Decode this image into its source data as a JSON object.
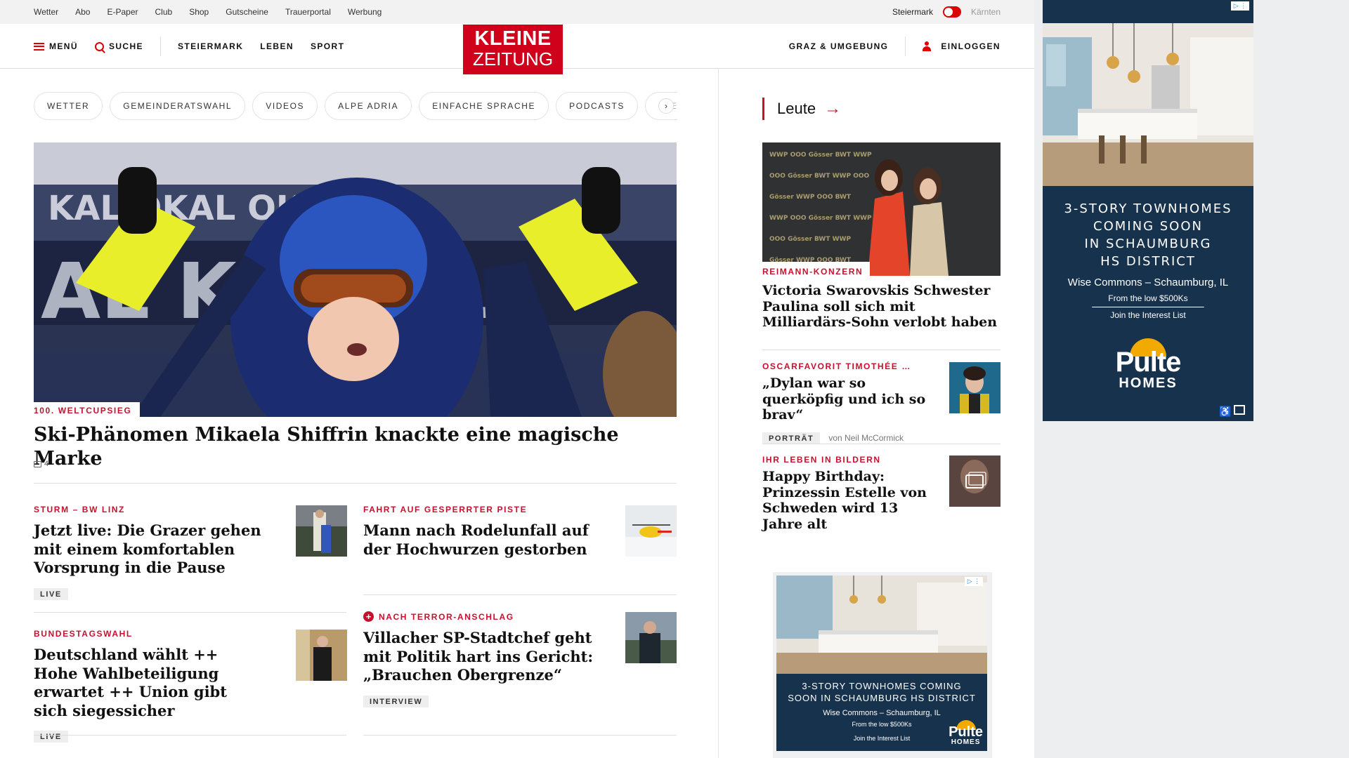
{
  "topbar": {
    "links": [
      "Wetter",
      "Abo",
      "E-Paper",
      "Club",
      "Shop",
      "Gutscheine",
      "Trauerportal",
      "Werbung"
    ],
    "region_active": "Steiermark",
    "region_other": "Kärnten"
  },
  "nav": {
    "menu_label": "MENÜ",
    "search_label": "SUCHE",
    "items": [
      "STEIERMARK",
      "LEBEN",
      "SPORT"
    ],
    "logo_line1": "KLEINE",
    "logo_line2": "ZEITUNG",
    "graz_label": "GRAZ & UMGEBUNG",
    "login_label": "EINLOGGEN"
  },
  "chips": [
    "WETTER",
    "GEMEINDERATSWAHL",
    "VIDEOS",
    "ALPE ADRIA",
    "EINFACHE SPRACHE",
    "PODCASTS",
    "KLEINE"
  ],
  "hero": {
    "tag": "100. WELTCUPSIEG",
    "title": "Ski-Phänomen Mikaela Shiffrin knackte eine magische Marke",
    "comments": "4"
  },
  "articles": {
    "a1": {
      "tag": "STURM – BW LINZ",
      "title": "Jetzt live: Die Grazer gehen mit einem komfortablen Vorsprung in die Pause",
      "badge": "LIVE"
    },
    "a2": {
      "tag": "FAHRT AUF GESPERRTER PISTE",
      "title": "Mann nach Rodelunfall auf der Hochwurzen gestorben"
    },
    "a3": {
      "tag": "BUNDESTAGSWAHL",
      "title": "Deutschland wählt ++ Hohe Wahlbeteiligung erwartet ++ Union gibt sich siegessicher",
      "badge": "LIVE"
    },
    "a4": {
      "tag": "NACH TERROR-ANSCHLAG",
      "title": "Villacher SP-Stadtchef geht mit Politik hart ins Gericht: „Brauchen Obergrenze“",
      "badge": "INTERVIEW"
    }
  },
  "sidebar": {
    "heading": "Leute",
    "main": {
      "tag": "REIMANN-KONZERN",
      "title": "Victoria Swarovskis Schwester Paulina soll sich mit Milliardärs-Sohn verlobt haben"
    },
    "s2": {
      "tag": "OSCARFAVORIT TIMOTHÉE …",
      "title": "„Dylan war so querköpfig und ich so brav“",
      "badge": "PORTRÄT",
      "author": "von Neil McCormick"
    },
    "s3": {
      "tag": "IHR LEBEN IN BILDERN",
      "title": "Happy Birthday: Prinzessin Estelle von Schweden wird 13 Jahre alt"
    }
  },
  "ad_top": {
    "headline": [
      "3-STORY TOWNHOMES",
      "COMING SOON",
      "IN SCHAUMBURG",
      "HS DISTRICT"
    ],
    "location": "Wise Commons – Schaumburg, IL",
    "price": "From the low $500Ks",
    "cta": "Join the Interest List",
    "brand1": "Pulte",
    "brand2": "HOMES"
  },
  "ad_mid": {
    "headline1": "3-STORY TOWNHOMES COMING",
    "headline2": "SOON IN SCHAUMBURG HS DISTRICT",
    "location": "Wise Commons – Schaumburg, IL",
    "price": "From the low $500Ks",
    "cta": "Join the Interest List",
    "brand1": "Pulte",
    "brand2": "HOMES"
  },
  "colors": {
    "brand_red": "#d0021b",
    "ad_navy": "#17324d",
    "ad_gold": "#f2a900"
  }
}
